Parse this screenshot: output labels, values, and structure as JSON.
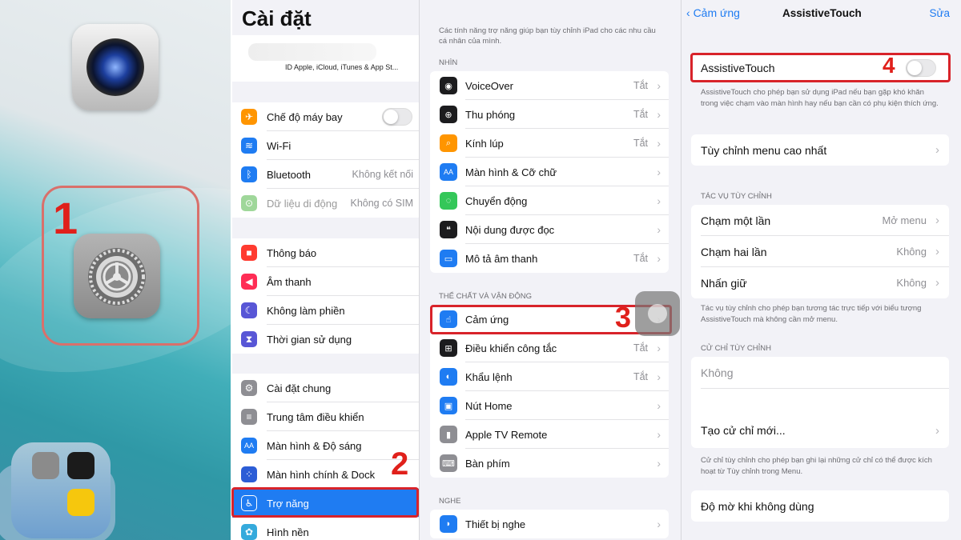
{
  "steps": [
    "1",
    "2",
    "3",
    "4"
  ],
  "settings": {
    "title": "Cài đặt",
    "apple_id_subtitle": "ID Apple, iCloud, iTunes & App St...",
    "group1": [
      {
        "label": "Chế độ máy bay",
        "value": "",
        "icon": "airplane-icon",
        "color": "#ff9500"
      },
      {
        "label": "Wi-Fi",
        "value": "",
        "icon": "wifi-icon",
        "color": "#1f7cf2"
      },
      {
        "label": "Bluetooth",
        "value": "Không kết nối",
        "icon": "bluetooth-icon",
        "color": "#1f7cf2"
      },
      {
        "label": "Dữ liệu di động",
        "value": "Không có SIM",
        "icon": "cellular-icon",
        "color": "#9fd79a"
      }
    ],
    "group2": [
      {
        "label": "Thông báo",
        "icon": "notifications-icon",
        "color": "#ff3b30"
      },
      {
        "label": "Âm thanh",
        "icon": "sound-icon",
        "color": "#ff2d55"
      },
      {
        "label": "Không làm phiền",
        "icon": "moon-icon",
        "color": "#5856d6"
      },
      {
        "label": "Thời gian sử dụng",
        "icon": "hourglass-icon",
        "color": "#5856d6"
      }
    ],
    "group3": [
      {
        "label": "Cài đặt chung",
        "icon": "gear-icon",
        "color": "#8e8e93"
      },
      {
        "label": "Trung tâm điều khiển",
        "icon": "control-center-icon",
        "color": "#8e8e93"
      },
      {
        "label": "Màn hình & Độ sáng",
        "icon": "display-icon",
        "color": "#1f7cf2"
      },
      {
        "label": "Màn hình chính & Dock",
        "icon": "home-screen-icon",
        "color": "#2c5dd6"
      },
      {
        "label": "Trợ năng",
        "icon": "accessibility-icon",
        "color": "#1f7cf2"
      },
      {
        "label": "Hình nền",
        "icon": "wallpaper-icon",
        "color": "#35aadc"
      }
    ]
  },
  "accessibility": {
    "description": "Các tính năng trợ năng giúp bạn tùy chỉnh iPad cho các nhu cầu cá nhân của mình.",
    "section_vision": "NHÌN",
    "vision": [
      {
        "label": "VoiceOver",
        "value": "Tắt",
        "icon": "voiceover-icon",
        "color": "#1c1c1e"
      },
      {
        "label": "Thu phóng",
        "value": "Tắt",
        "icon": "zoom-icon",
        "color": "#1c1c1e"
      },
      {
        "label": "Kính lúp",
        "value": "Tắt",
        "icon": "magnifier-icon",
        "color": "#ff9500"
      },
      {
        "label": "Màn hình & Cỡ chữ",
        "value": "",
        "icon": "text-size-icon",
        "color": "#1f7cf2"
      },
      {
        "label": "Chuyển động",
        "value": "",
        "icon": "motion-icon",
        "color": "#34c759"
      },
      {
        "label": "Nội dung được đọc",
        "value": "",
        "icon": "spoken-content-icon",
        "color": "#1c1c1e"
      },
      {
        "label": "Mô tả âm thanh",
        "value": "Tắt",
        "icon": "audio-description-icon",
        "color": "#1f7cf2"
      }
    ],
    "section_physical": "THỂ CHẤT VÀ VẬN ĐỘNG",
    "physical": [
      {
        "label": "Cảm ứng",
        "value": "",
        "icon": "touch-icon",
        "color": "#1f7cf2"
      },
      {
        "label": "Điều khiển công tắc",
        "value": "Tắt",
        "icon": "switch-control-icon",
        "color": "#1c1c1e"
      },
      {
        "label": "Khẩu lệnh",
        "value": "Tắt",
        "icon": "voice-control-icon",
        "color": "#1f7cf2"
      },
      {
        "label": "Nút Home",
        "value": "",
        "icon": "home-button-icon",
        "color": "#1f7cf2"
      },
      {
        "label": "Apple TV Remote",
        "value": "",
        "icon": "remote-icon",
        "color": "#8e8e93"
      },
      {
        "label": "Bàn phím",
        "value": "",
        "icon": "keyboard-icon",
        "color": "#8e8e93"
      }
    ],
    "section_hearing": "NGHE",
    "hearing": [
      {
        "label": "Thiết bị nghe",
        "value": "",
        "icon": "hearing-icon",
        "color": "#1f7cf2"
      }
    ]
  },
  "assistivetouch": {
    "back_label": "Cảm ứng",
    "title": "AssistiveTouch",
    "edit_label": "Sửa",
    "toggle_label": "AssistiveTouch",
    "toggle_on": false,
    "toggle_note": "AssistiveTouch cho phép bạn sử dụng iPad nếu bạn gặp khó khăn trong việc chạm vào màn hình hay nếu bạn cần có phụ kiện thích ứng.",
    "customize_menu": "Tùy chỉnh menu cao nhất",
    "section_custom_actions": "TÁC VỤ TÙY CHỈNH",
    "actions": [
      {
        "label": "Chạm một lần",
        "value": "Mở menu"
      },
      {
        "label": "Chạm hai lần",
        "value": "Không"
      },
      {
        "label": "Nhấn giữ",
        "value": "Không"
      }
    ],
    "actions_note": "Tác vụ tùy chỉnh cho phép bạn tương tác trực tiếp với biểu tượng AssistiveTouch mà không cần mở menu.",
    "section_custom_gestures": "CỬ CHỈ TÙY CHỈNH",
    "gestures_none": "Không",
    "create_gesture": "Tạo cử chỉ mới...",
    "gestures_note": "Cử chỉ tùy chỉnh cho phép bạn ghi lại những cử chỉ có thể được kích hoạt từ Tùy chỉnh trong Menu.",
    "idle_opacity": "Độ mờ khi không dùng"
  }
}
